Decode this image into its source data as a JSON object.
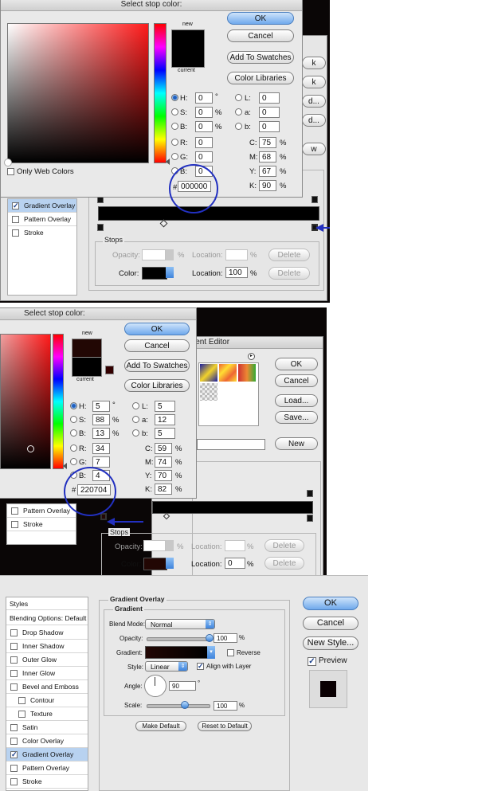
{
  "panel1": {
    "color_picker": {
      "title": "Select stop color:",
      "new_label": "new",
      "current_label": "current",
      "only_web_colors": "Only Web Colors",
      "buttons": {
        "ok": "OK",
        "cancel": "Cancel",
        "add_to_swatches": "Add To Swatches",
        "color_libraries": "Color Libraries"
      },
      "fields": {
        "h": {
          "label": "H:",
          "value": "0",
          "unit": "°"
        },
        "s": {
          "label": "S:",
          "value": "0",
          "unit": "%"
        },
        "b": {
          "label": "B:",
          "value": "0",
          "unit": "%"
        },
        "r": {
          "label": "R:",
          "value": "0"
        },
        "g": {
          "label": "G:",
          "value": "0"
        },
        "bb": {
          "label": "B:",
          "value": "0"
        },
        "l": {
          "label": "L:",
          "value": "0"
        },
        "a": {
          "label": "a:",
          "value": "0"
        },
        "b2": {
          "label": "b:",
          "value": "0"
        },
        "c": {
          "label": "C:",
          "value": "75",
          "unit": "%"
        },
        "m": {
          "label": "M:",
          "value": "68",
          "unit": "%"
        },
        "y": {
          "label": "Y:",
          "value": "67",
          "unit": "%"
        },
        "k": {
          "label": "K:",
          "value": "90",
          "unit": "%"
        },
        "hex": {
          "label": "#",
          "value": "000000"
        }
      },
      "new_color": "#000000",
      "current_color": "#000000"
    },
    "styles_list": [
      {
        "label": "Gradient Overlay",
        "checked": true,
        "selected": true
      },
      {
        "label": "Pattern Overlay",
        "checked": false
      },
      {
        "label": "Stroke",
        "checked": false
      }
    ],
    "stops": {
      "title": "Stops",
      "opacity_label": "Opacity:",
      "location_label": "Location:",
      "delete_label": "Delete",
      "color_label": "Color:",
      "location_value": "100",
      "percent": "%",
      "color_swatch": "#000000"
    },
    "side_buttons": {
      "k1": "k",
      "d": "d...",
      "w": "w"
    }
  },
  "panel2": {
    "color_picker": {
      "title": "Select stop color:",
      "new_label": "new",
      "current_label": "current",
      "buttons": {
        "ok": "OK",
        "cancel": "Cancel",
        "add_to_swatches": "Add To Swatches",
        "color_libraries": "Color Libraries"
      },
      "fields": {
        "h": {
          "label": "H:",
          "value": "5",
          "unit": "°"
        },
        "s": {
          "label": "S:",
          "value": "88",
          "unit": "%"
        },
        "b": {
          "label": "B:",
          "value": "13",
          "unit": "%"
        },
        "r": {
          "label": "R:",
          "value": "34"
        },
        "g": {
          "label": "G:",
          "value": "7"
        },
        "bb": {
          "label": "B:",
          "value": "4"
        },
        "l": {
          "label": "L:",
          "value": "5"
        },
        "a": {
          "label": "a:",
          "value": "12"
        },
        "b2": {
          "label": "b:",
          "value": "5"
        },
        "c": {
          "label": "C:",
          "value": "59",
          "unit": "%"
        },
        "m": {
          "label": "M:",
          "value": "74",
          "unit": "%"
        },
        "y": {
          "label": "Y:",
          "value": "70",
          "unit": "%"
        },
        "k": {
          "label": "K:",
          "value": "82",
          "unit": "%"
        },
        "hex": {
          "label": "#",
          "value": "220704"
        }
      },
      "new_color": "#220704",
      "current_color": "#000000"
    },
    "gradient_editor": {
      "title": "ient Editor",
      "buttons": {
        "ok": "OK",
        "cancel": "Cancel",
        "load": "Load...",
        "save": "Save...",
        "new": "New"
      }
    },
    "styles_list": [
      {
        "label": "Pattern Overlay",
        "checked": false
      },
      {
        "label": "Stroke",
        "checked": false
      }
    ],
    "stops": {
      "title": "Stops",
      "opacity_label": "Opacity:",
      "location_label": "Location:",
      "delete_label": "Delete",
      "color_label": "Color:",
      "location_value": "0",
      "percent": "%",
      "color_swatch": "#220704"
    }
  },
  "panel3": {
    "styles_header": "Styles",
    "blending_options": "Blending Options: Default",
    "styles_list": [
      {
        "label": "Drop Shadow",
        "checked": false
      },
      {
        "label": "Inner Shadow",
        "checked": false
      },
      {
        "label": "Outer Glow",
        "checked": false
      },
      {
        "label": "Inner Glow",
        "checked": false
      },
      {
        "label": "Bevel and Emboss",
        "checked": false
      },
      {
        "label": "Contour",
        "checked": false
      },
      {
        "label": "Texture",
        "checked": false
      },
      {
        "label": "Satin",
        "checked": false
      },
      {
        "label": "Color Overlay",
        "checked": false
      },
      {
        "label": "Gradient Overlay",
        "checked": true,
        "selected": true
      },
      {
        "label": "Pattern Overlay",
        "checked": false
      },
      {
        "label": "Stroke",
        "checked": false
      }
    ],
    "gradient_overlay_title": "Gradient Overlay",
    "gradient_group": "Gradient",
    "blend_mode_label": "Blend Mode:",
    "blend_mode_value": "Normal",
    "opacity_label": "Opacity:",
    "opacity_value": "100",
    "gradient_label": "Gradient:",
    "reverse_label": "Reverse",
    "style_label": "Style:",
    "style_value": "Linear",
    "align_label": "Align with Layer",
    "angle_label": "Angle:",
    "angle_value": "90",
    "degree": "°",
    "scale_label": "Scale:",
    "scale_value": "100",
    "percent": "%",
    "make_default": "Make Default",
    "reset_default": "Reset to Default",
    "buttons": {
      "ok": "OK",
      "cancel": "Cancel",
      "new_style": "New Style...",
      "preview": "Preview"
    }
  }
}
